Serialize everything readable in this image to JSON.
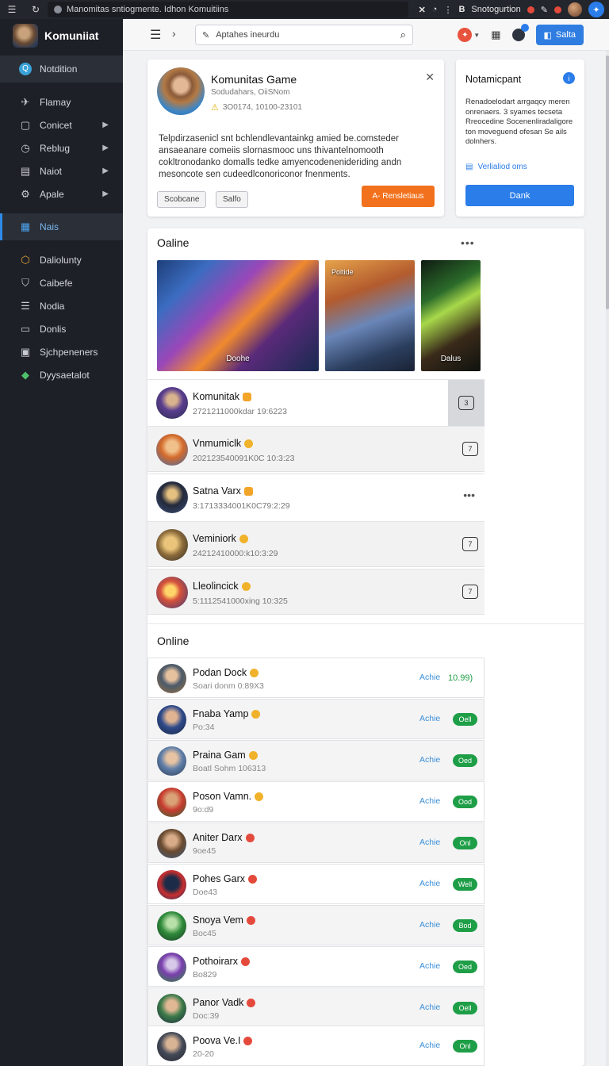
{
  "browser": {
    "url_text": "Manomitas sntiogmente. Idhon Komuitiins",
    "extension_label": "Snotogurtion"
  },
  "sidebar": {
    "brand": "Komuniiat",
    "items": [
      {
        "label": "Notdition",
        "icon": "q-icon"
      },
      {
        "label": "Flamay",
        "icon": "plane-icon"
      },
      {
        "label": "Conicet",
        "icon": "square-icon",
        "chevron": true
      },
      {
        "label": "Reblug",
        "icon": "clock-icon",
        "chevron": true
      },
      {
        "label": "Naiot",
        "icon": "doc-icon",
        "chevron": true
      },
      {
        "label": "Apale",
        "icon": "gear-icon",
        "chevron": true
      },
      {
        "label": "Nais",
        "icon": "grid-icon",
        "active": true
      },
      {
        "label": "Daliolunty",
        "icon": "cube-icon"
      },
      {
        "label": "Caibefe",
        "icon": "shield-icon"
      },
      {
        "label": "Nodia",
        "icon": "list-icon"
      },
      {
        "label": "Donlis",
        "icon": "folder-icon"
      },
      {
        "label": "Sjchpeneners",
        "icon": "terminal-icon"
      },
      {
        "label": "Dyysaetalot",
        "icon": "diamond-icon"
      }
    ]
  },
  "topbar": {
    "search_placeholder": "Aptahes ineurdu",
    "save_label": "Salta"
  },
  "hero": {
    "title": "Komunitas Game",
    "subtitle": "Sodudahars, OiiSNom",
    "warning": "3O0174, 10100-23101",
    "description": "Telpdirzasenicl snt bchlendlevantainkg amied be.comsteder ansaeanare comeiis slornasmooc uns thivantelnomooth cokltronodanko domalls tedke amyencodenenideriding andn mesoncote sen cudeedlconoriconor fnenments.",
    "btn1": "Scobcane",
    "btn2": "Salfo",
    "cta": "A- Rensletiaus"
  },
  "notification": {
    "title": "Notamicpant",
    "body": "Renadoelodart arrgaqcy meren onrenaers. 3 syames tecseta Rreocedine Socenenliradaligore ton moveguend ofesan Se ails dolnhers.",
    "link": "Verlialiod oms",
    "button": "Dank"
  },
  "community": {
    "section_title": "Oaline",
    "banners": [
      {
        "caption": "Doohe",
        "tag": ""
      },
      {
        "caption": "",
        "tag": "Poltide"
      },
      {
        "caption": "Dalus",
        "tag": ""
      }
    ],
    "rows": [
      {
        "name": "Komunitak",
        "meta": "2721211000kdar 19:6223",
        "count": "3"
      },
      {
        "name": "Vnmumiclk",
        "meta": "202123540091K0C 10:3:23",
        "count": "7"
      },
      {
        "name": "Satna Varx",
        "meta": "3:1713334001K0C79:2:29",
        "count": ""
      },
      {
        "name": "Veminiork",
        "meta": "24212410000:k10:3:29",
        "count": "7"
      },
      {
        "name": "Lleolincick",
        "meta": "5:1112541000xing 10:325",
        "count": "7"
      }
    ]
  },
  "online": {
    "section_title": "Online",
    "status_label": "Achie",
    "rows": [
      {
        "name": "Podan Dock",
        "meta": "Soari donm 0:89X3",
        "pill": "10.99)"
      },
      {
        "name": "Fnaba Yamp",
        "meta": "Po:34",
        "pill": "Oell"
      },
      {
        "name": "Praina Gam",
        "meta": "Boatl Sohm 106313",
        "pill": "Oed"
      },
      {
        "name": "Poson Vamn.",
        "meta": "9o:d9",
        "pill": "Ood"
      },
      {
        "name": "Aniter Darx",
        "meta": "9oe45",
        "pill": "Onl"
      },
      {
        "name": "Pohes Garx",
        "meta": "Doe43",
        "pill": "Well"
      },
      {
        "name": "Snoya Vem",
        "meta": "Boc45",
        "pill": "Bod"
      },
      {
        "name": "Pothoirarx",
        "meta": "Bo829",
        "pill": "Oed"
      },
      {
        "name": "Panor Vadk",
        "meta": "Doc:39",
        "pill": "Oell"
      },
      {
        "name": "Poova Ve.I",
        "meta": "20-20",
        "pill": "Onl"
      }
    ]
  }
}
